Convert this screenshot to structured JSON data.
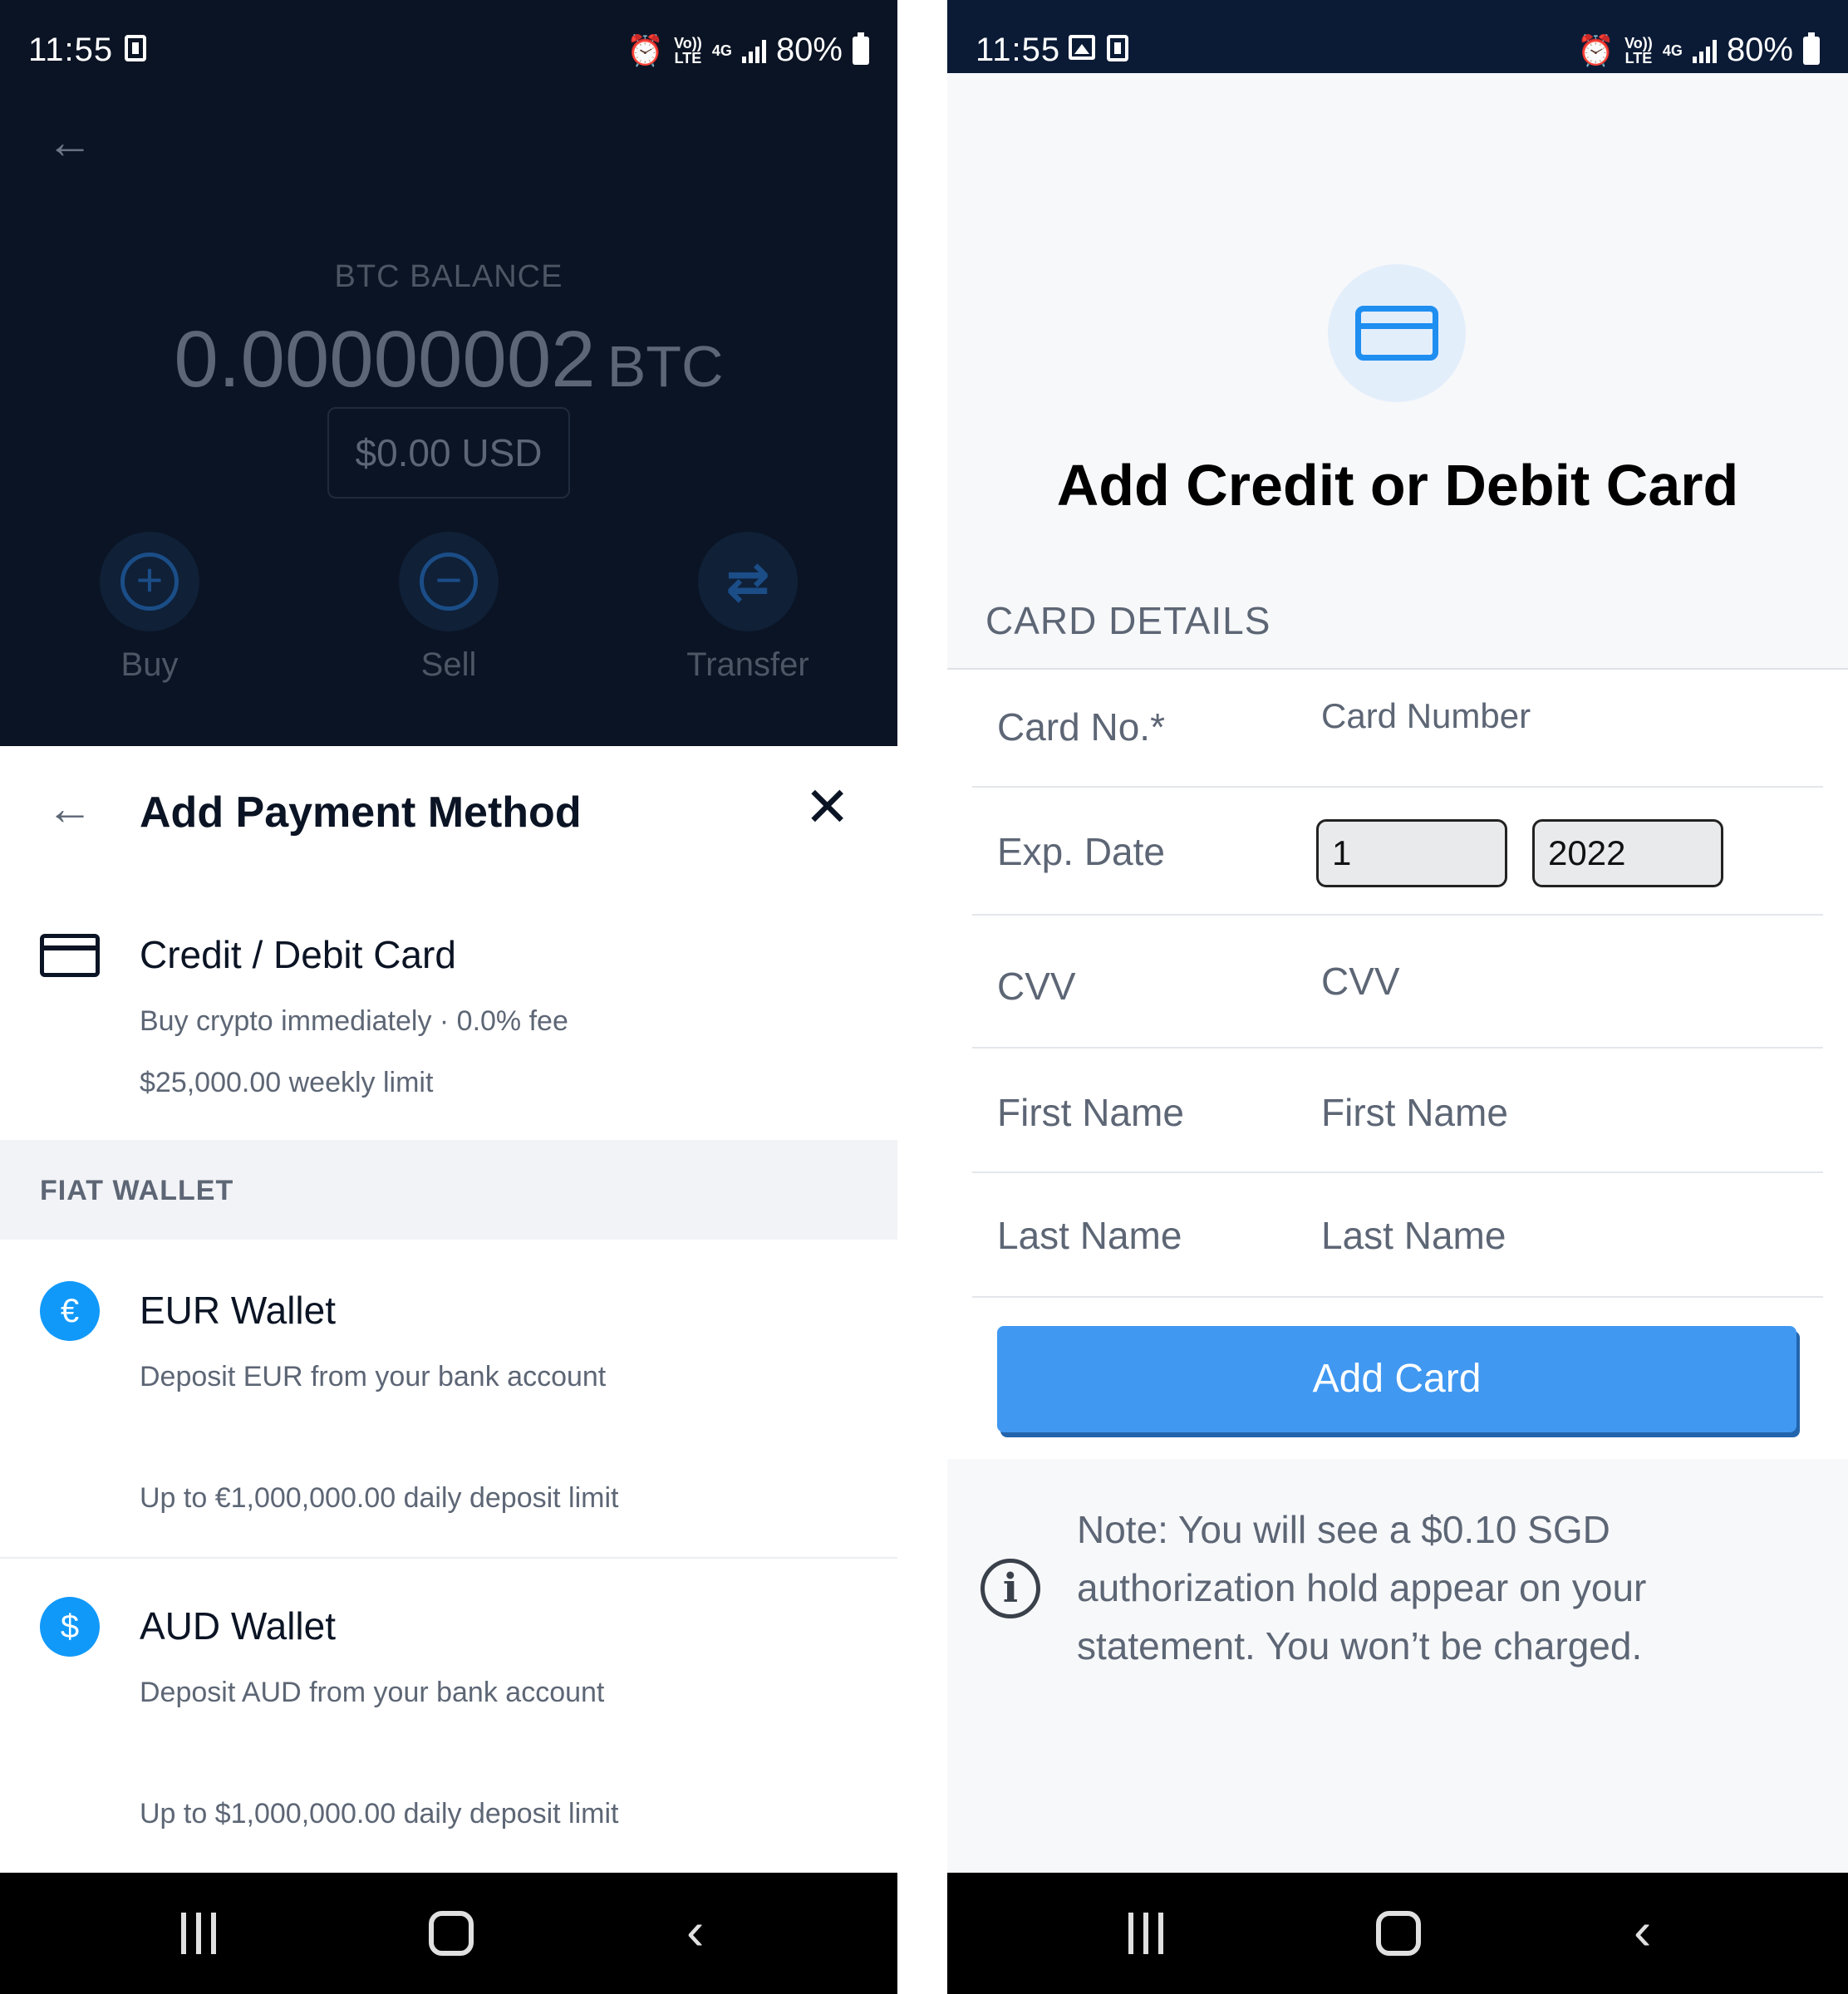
{
  "left": {
    "status": {
      "time": "11:55",
      "volte": "Vo)) LTE",
      "network": "4G",
      "battery": "80%"
    },
    "balance": {
      "label": "BTC BALANCE",
      "amount": "0.00000002",
      "unit": "BTC",
      "fiat": "$0.00 USD"
    },
    "actions": [
      {
        "label": "Buy",
        "icon": "plus-circle-icon"
      },
      {
        "label": "Sell",
        "icon": "minus-circle-icon"
      },
      {
        "label": "Transfer",
        "icon": "transfer-arrows-icon"
      }
    ],
    "sheet": {
      "title": "Add Payment Method",
      "card_option": {
        "title": "Credit / Debit Card",
        "subtitle": "Buy crypto immediately · 0.0% fee",
        "limit": "$25,000.00 weekly limit"
      },
      "section_label": "FIAT WALLET",
      "wallets": [
        {
          "symbol": "€",
          "title": "EUR Wallet",
          "subtitle": "Deposit EUR from your bank account",
          "limit": "Up to €1,000,000.00 daily deposit limit"
        },
        {
          "symbol": "$",
          "title": "AUD Wallet",
          "subtitle": "Deposit AUD from your bank account",
          "limit": "Up to $1,000,000.00 daily deposit limit"
        }
      ]
    }
  },
  "right": {
    "status": {
      "time": "11:55",
      "volte": "Vo)) LTE",
      "network": "4G",
      "battery": "80%"
    },
    "title": "Add Credit or Debit Card",
    "section_label": "CARD DETAILS",
    "fields": {
      "card_no": {
        "label": "Card No.*",
        "placeholder": "Card Number"
      },
      "exp": {
        "label": "Exp. Date",
        "month": "1",
        "year": "2022"
      },
      "cvv": {
        "label": "CVV",
        "placeholder": "CVV"
      },
      "first": {
        "label": "First Name",
        "placeholder": "First Name"
      },
      "last": {
        "label": "Last Name",
        "placeholder": "Last Name"
      }
    },
    "button": "Add Card",
    "note": "Note: You will see a $0.10 SGD authorization hold appear on your statement. You won’t be charged."
  },
  "colors": {
    "accent": "#1199fa",
    "button": "#4098f1",
    "dark_bg": "#0b1424"
  }
}
